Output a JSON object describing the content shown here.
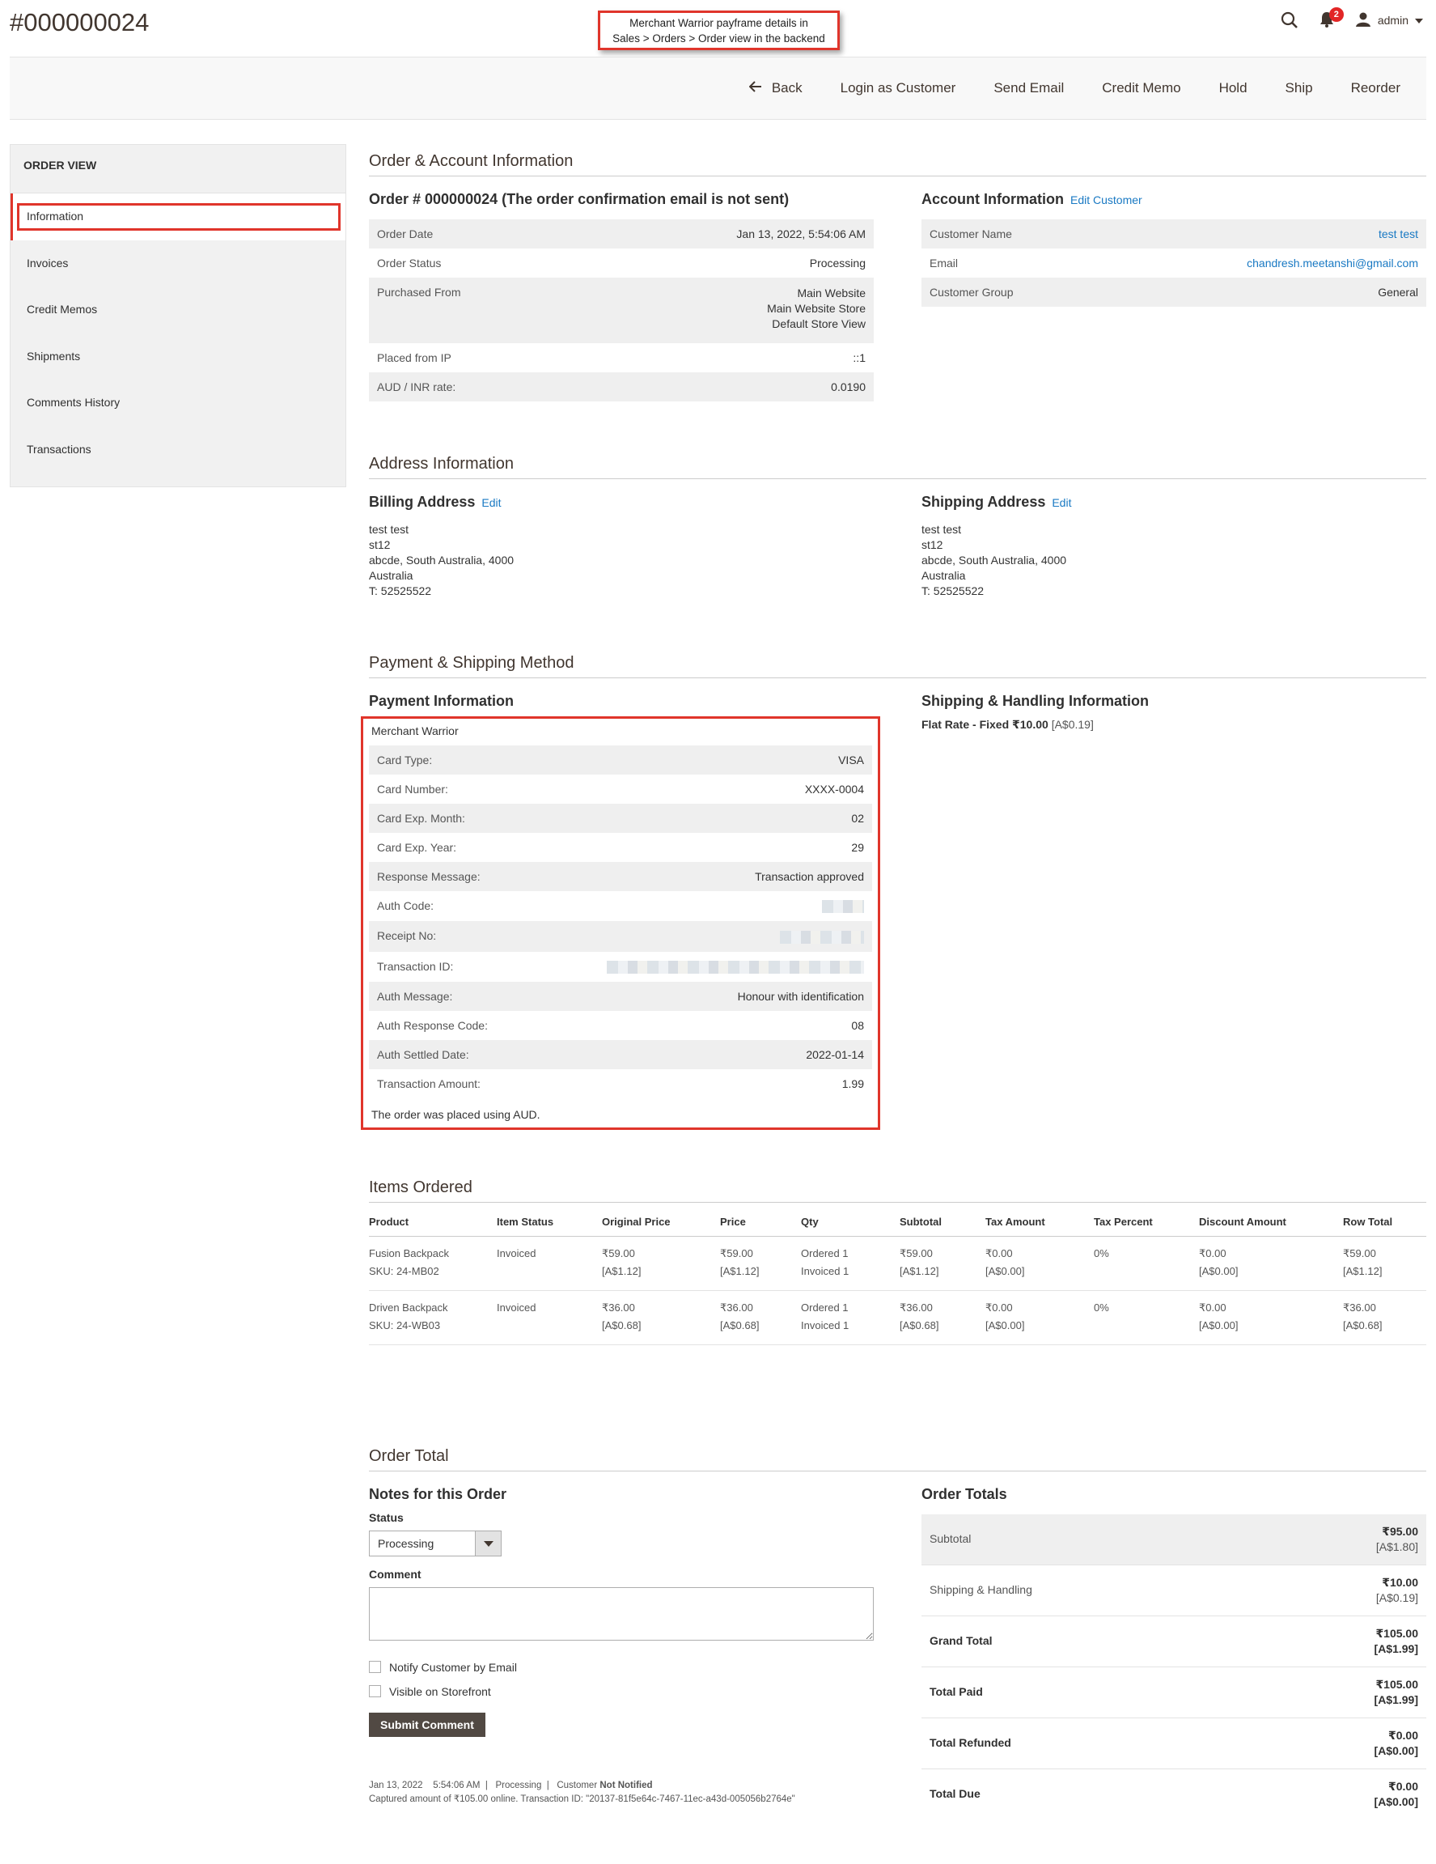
{
  "page_title": "#000000024",
  "annotation": {
    "line1": "Merchant Warrior payframe details in",
    "line2": "Sales > Orders > Order view in the backend"
  },
  "header": {
    "notifications_count": "2",
    "admin_label": "admin"
  },
  "actions": [
    "Back",
    "Login as Customer",
    "Send Email",
    "Credit Memo",
    "Hold",
    "Ship",
    "Reorder"
  ],
  "sidebar": {
    "title": "ORDER VIEW",
    "items": [
      "Information",
      "Invoices",
      "Credit Memos",
      "Shipments",
      "Comments History",
      "Transactions"
    ]
  },
  "order_account": {
    "section_title": "Order & Account Information",
    "order_title": "Order # 000000024 (The order confirmation email is not sent)",
    "order_rows": [
      {
        "label": "Order Date",
        "value": "Jan 13, 2022, 5:54:06 AM"
      },
      {
        "label": "Order Status",
        "value": "Processing"
      },
      {
        "label": "Purchased From",
        "value1": "Main Website",
        "value2": "Main Website Store",
        "value3": "Default Store View"
      },
      {
        "label": "Placed from IP",
        "value": "::1"
      },
      {
        "label": "AUD / INR rate:",
        "value": "0.0190"
      }
    ],
    "account_title": "Account Information",
    "edit_customer": "Edit Customer",
    "account_rows": [
      {
        "label": "Customer Name",
        "value": "test test"
      },
      {
        "label": "Email",
        "value": "chandresh.meetanshi@gmail.com"
      },
      {
        "label": "Customer Group",
        "value": "General"
      }
    ]
  },
  "address": {
    "section_title": "Address Information",
    "billing_title": "Billing Address",
    "shipping_title": "Shipping Address",
    "edit": "Edit",
    "lines": [
      "test test",
      "st12",
      "abcde, South Australia, 4000",
      "Australia",
      "T: 52525522"
    ]
  },
  "payment_shipping": {
    "section_title": "Payment & Shipping Method",
    "payment_title": "Payment Information",
    "method": "Merchant Warrior",
    "rows": [
      {
        "label": "Card Type:",
        "value": "VISA"
      },
      {
        "label": "Card Number:",
        "value": "XXXX-0004"
      },
      {
        "label": "Card Exp. Month:",
        "value": "02"
      },
      {
        "label": "Card Exp. Year:",
        "value": "29"
      },
      {
        "label": "Response Message:",
        "value": "Transaction approved"
      },
      {
        "label": "Auth Code:",
        "value": ""
      },
      {
        "label": "Receipt No:",
        "value": ""
      },
      {
        "label": "Transaction ID:",
        "value": ""
      },
      {
        "label": "Auth Message:",
        "value": "Honour with identification"
      },
      {
        "label": "Auth Response Code:",
        "value": "08"
      },
      {
        "label": "Auth Settled Date:",
        "value": "2022-01-14"
      },
      {
        "label": "Transaction Amount:",
        "value": "1.99"
      }
    ],
    "footer": "The order was placed using AUD.",
    "shipping_title": "Shipping & Handling Information",
    "shipping_method": "Flat Rate - Fixed ₹10.00",
    "shipping_aud": "[A$0.19]"
  },
  "items": {
    "section_title": "Items Ordered",
    "headers": [
      "Product",
      "Item Status",
      "Original Price",
      "Price",
      "Qty",
      "Subtotal",
      "Tax Amount",
      "Tax Percent",
      "Discount Amount",
      "Row Total"
    ],
    "rows": [
      {
        "name": "Fusion Backpack",
        "sku": "SKU: 24-MB02",
        "status": "Invoiced",
        "orig": "₹59.00",
        "orig_a": "[A$1.12]",
        "price": "₹59.00",
        "price_a": "[A$1.12]",
        "qty1": "Ordered 1",
        "qty2": "Invoiced 1",
        "sub": "₹59.00",
        "sub_a": "[A$1.12]",
        "tax": "₹0.00",
        "tax_a": "[A$0.00]",
        "taxp": "0%",
        "disc": "₹0.00",
        "disc_a": "[A$0.00]",
        "row": "₹59.00",
        "row_a": "[A$1.12]"
      },
      {
        "name": "Driven Backpack",
        "sku": "SKU: 24-WB03",
        "status": "Invoiced",
        "orig": "₹36.00",
        "orig_a": "[A$0.68]",
        "price": "₹36.00",
        "price_a": "[A$0.68]",
        "qty1": "Ordered 1",
        "qty2": "Invoiced 1",
        "sub": "₹36.00",
        "sub_a": "[A$0.68]",
        "tax": "₹0.00",
        "tax_a": "[A$0.00]",
        "taxp": "0%",
        "disc": "₹0.00",
        "disc_a": "[A$0.00]",
        "row": "₹36.00",
        "row_a": "[A$0.68]"
      }
    ]
  },
  "order_total": {
    "section_title": "Order Total",
    "notes_title": "Notes for this Order",
    "status_label": "Status",
    "status_value": "Processing",
    "comment_label": "Comment",
    "notify": "Notify Customer by Email",
    "visible": "Visible on Storefront",
    "submit": "Submit Comment",
    "history_date": "Jan 13, 2022",
    "history_time": "5:54:06 AM",
    "history_status": "Processing",
    "history_customer": "Customer",
    "history_notified": "Not Notified",
    "history_note": "Captured amount of ₹105.00 online. Transaction ID: \"20137-81f5e64c-7467-11ec-a43d-005056b2764e\"",
    "totals_title": "Order Totals",
    "totals": [
      {
        "label": "Subtotal",
        "inr": "₹95.00",
        "aud": "[A$1.80]"
      },
      {
        "label": "Shipping & Handling",
        "inr": "₹10.00",
        "aud": "[A$0.19]"
      },
      {
        "label": "Grand Total",
        "inr": "₹105.00",
        "aud": "[A$1.99]"
      },
      {
        "label": "Total Paid",
        "inr": "₹105.00",
        "aud": "[A$1.99]"
      },
      {
        "label": "Total Refunded",
        "inr": "₹0.00",
        "aud": "[A$0.00]"
      },
      {
        "label": "Total Due",
        "inr": "₹0.00",
        "aud": "[A$0.00]"
      }
    ]
  }
}
